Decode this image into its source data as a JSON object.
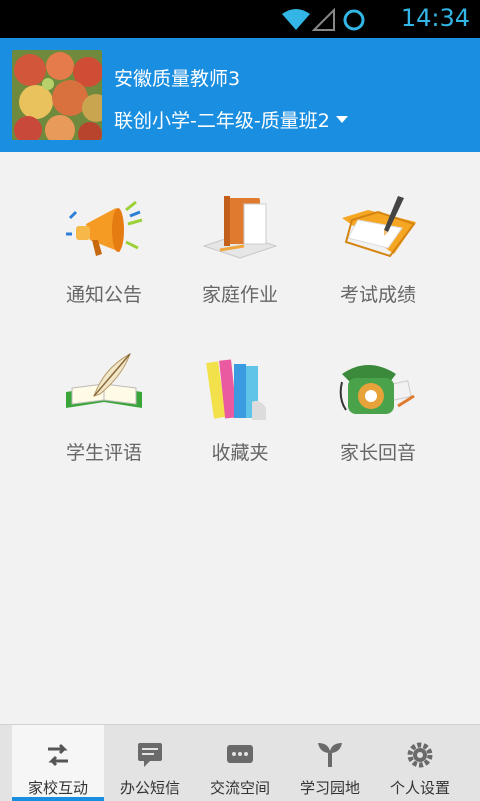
{
  "status_bar": {
    "time": "14:34",
    "accent": "#33b5e5",
    "icons": [
      "wifi-icon",
      "signal-icon",
      "sync-icon"
    ]
  },
  "header": {
    "title": "安徽质量教师3",
    "subtitle": "联创小学-二年级-质量班2",
    "background": "#1a8ee0",
    "avatar": "peaches-photo"
  },
  "grid": {
    "items": [
      {
        "label": "通知公告",
        "icon": "megaphone-icon"
      },
      {
        "label": "家庭作业",
        "icon": "books-icon"
      },
      {
        "label": "考试成绩",
        "icon": "folder-pencil-icon"
      },
      {
        "label": "学生评语",
        "icon": "quill-book-icon"
      },
      {
        "label": "收藏夹",
        "icon": "bookshelf-icon"
      },
      {
        "label": "家长回音",
        "icon": "phone-icon"
      }
    ]
  },
  "tabs": {
    "items": [
      {
        "label": "家校互动",
        "icon": "arrows-swap-icon",
        "active": true
      },
      {
        "label": "办公短信",
        "icon": "message-icon",
        "active": false
      },
      {
        "label": "交流空间",
        "icon": "chat-icon",
        "active": false
      },
      {
        "label": "学习园地",
        "icon": "plant-icon",
        "active": false
      },
      {
        "label": "个人设置",
        "icon": "gear-icon",
        "active": false
      }
    ]
  }
}
